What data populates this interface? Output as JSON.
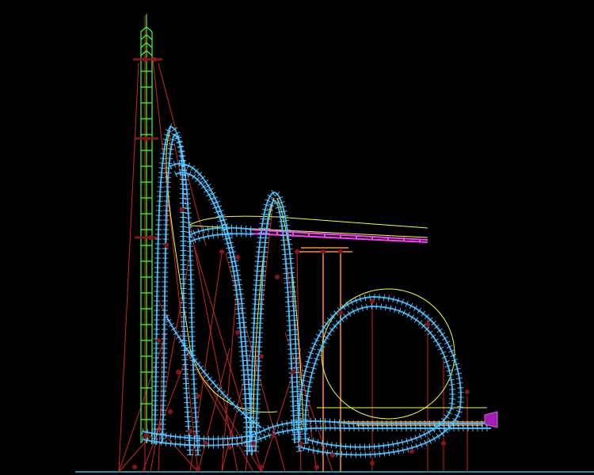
{
  "viewport": {
    "background": "#000000",
    "render_mode": "wireframe"
  },
  "colors": {
    "tower": "#3cff3c",
    "track": "#32b4ff",
    "track_rungs": "#7fd8ff",
    "supports": "#c8281e",
    "support_dots": "#8c1414",
    "heartline": "#f0ff3c",
    "brake_run": "#ff3cff",
    "platform": "#ff8c28",
    "ground_line": "#2a8ca0",
    "train_marker": "#a01eb4"
  },
  "scene": {
    "elements": [
      {
        "name": "launch-tower",
        "kind": "vertical lattice tower"
      },
      {
        "name": "top-hat-inversion",
        "kind": "track element"
      },
      {
        "name": "second-hill",
        "kind": "track element"
      },
      {
        "name": "vertical-loop",
        "kind": "track element"
      },
      {
        "name": "brake-run",
        "kind": "track element"
      },
      {
        "name": "station-platform",
        "kind": "structure"
      },
      {
        "name": "train",
        "kind": "vehicle marker"
      }
    ]
  }
}
